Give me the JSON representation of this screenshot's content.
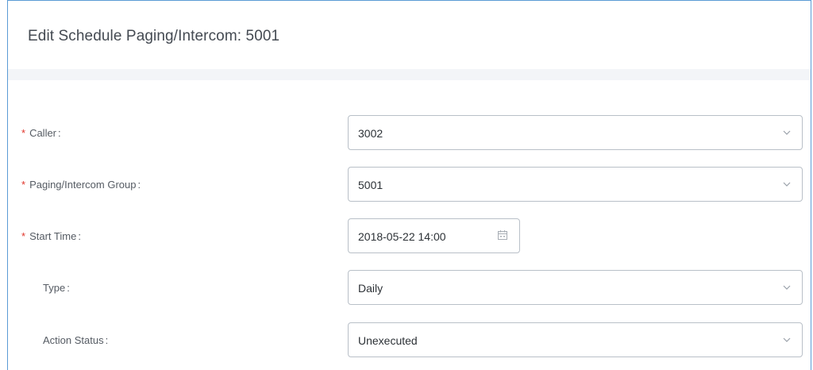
{
  "dialog": {
    "title": "Edit Schedule Paging/Intercom: 5001"
  },
  "form": {
    "caller": {
      "label": "Caller",
      "required": true,
      "value": "3002"
    },
    "group": {
      "label": "Paging/Intercom Group",
      "required": true,
      "value": "5001"
    },
    "start_time": {
      "label": "Start Time",
      "required": true,
      "value": "2018-05-22 14:00"
    },
    "type": {
      "label": "Type",
      "required": false,
      "value": "Daily"
    },
    "action_status": {
      "label": "Action Status",
      "required": false,
      "value": "Unexecuted"
    }
  },
  "icons": {
    "required_marker": "*",
    "colon": ":",
    "dropdown": "chevron-down-icon",
    "date": "calendar-icon"
  },
  "colors": {
    "border_accent": "#5b9bd5",
    "required": "#e0342a"
  }
}
